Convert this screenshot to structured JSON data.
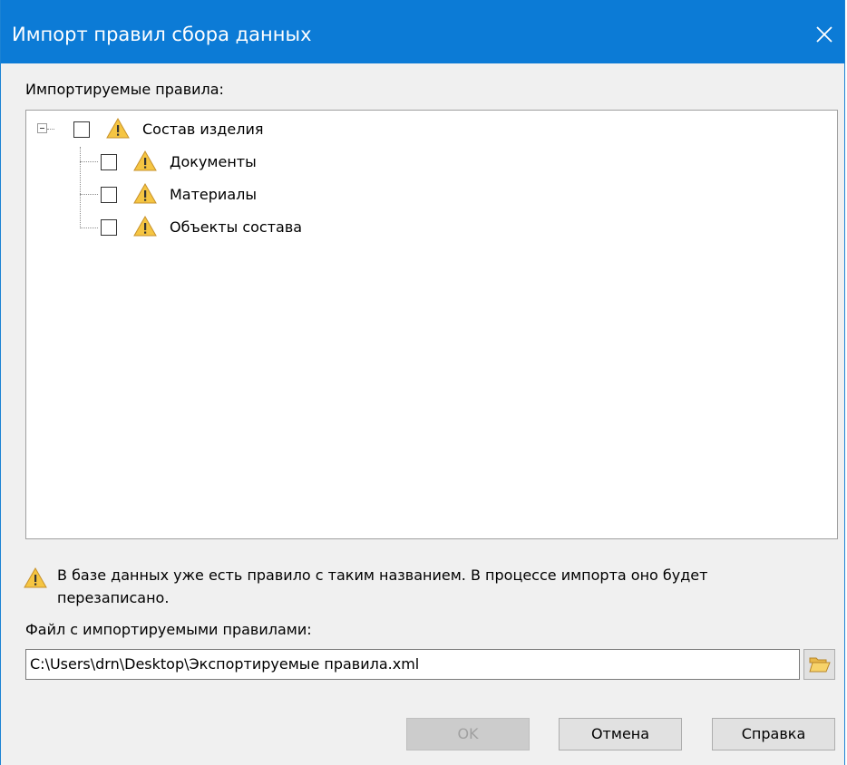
{
  "window": {
    "title": "Импорт правил сбора данных",
    "title_bar_color": "#0c7bd6"
  },
  "rules_section": {
    "label": "Импортируемые правила:",
    "tree": {
      "root": {
        "label": "Состав изделия",
        "expanded": true,
        "checked": false,
        "icon": "warning-icon"
      },
      "children": [
        {
          "label": "Документы",
          "checked": false,
          "icon": "warning-icon"
        },
        {
          "label": "Материалы",
          "checked": false,
          "icon": "warning-icon"
        },
        {
          "label": "Объекты состава",
          "checked": false,
          "icon": "warning-icon"
        }
      ]
    }
  },
  "warning": {
    "icon": "warning-icon",
    "line1": "В базе данных уже есть правило с таким названием. В процессе импорта оно будет",
    "line2": "перезаписано."
  },
  "file_section": {
    "label": "Файл с импортируемыми правилами:",
    "value": "C:\\Users\\drn\\Desktop\\Экспортируемые правила.xml",
    "browse_icon": "folder-open-icon"
  },
  "buttons": {
    "ok": "OK",
    "ok_enabled": false,
    "cancel": "Отмена",
    "help": "Справка"
  }
}
